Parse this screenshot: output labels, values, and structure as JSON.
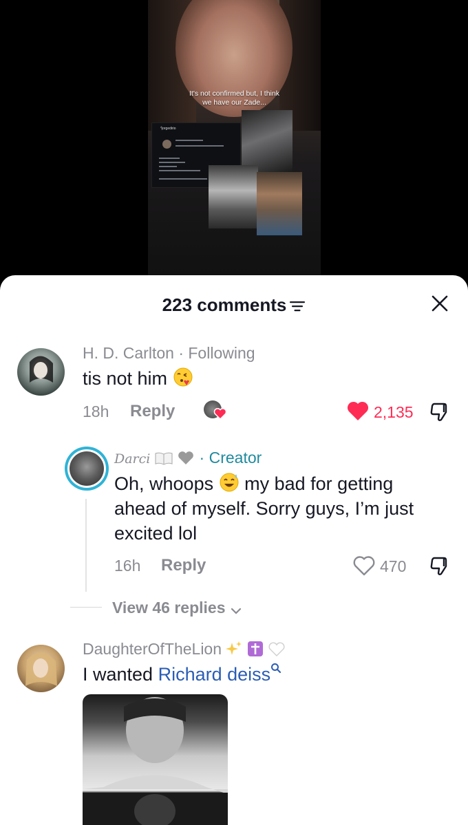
{
  "video": {
    "caption_line1": "It's not confirmed but, I think",
    "caption_line2": "we have our Zade...",
    "ig_handle": "jorgedirio"
  },
  "header": {
    "comments_count": "223 comments",
    "sort_icon": "sort-lines-icon",
    "close_icon": "close-x-icon"
  },
  "comments": [
    {
      "username": "H. D. Carlton",
      "status": "· Following",
      "text": "tis not him",
      "emoji": "kissing-face-emoji",
      "time": "18h",
      "reply_label": "Reply",
      "likes": "2,135",
      "liked": true,
      "creator_liked": true
    },
    {
      "username": "Darci",
      "role": "· Creator",
      "text_before_emoji": "Oh, whoops",
      "emoji": "sweat-smile-emoji",
      "text_after_emoji": "my bad for getting",
      "text_line2": "ahead of myself. Sorry guys, I’m just",
      "text_line3": "excited lol",
      "time": "16h",
      "reply_label": "Reply",
      "likes": "470",
      "liked": false
    },
    {
      "username": "DaughterOfTheLion",
      "text_prefix": "I wanted",
      "link_text": "Richard deiss"
    }
  ],
  "view_replies": "View 46 replies",
  "colors": {
    "accent_red": "#fe2c55",
    "creator_teal": "#1f8a9e",
    "link_blue": "#2b5db4",
    "muted_grey": "#8a8b91"
  }
}
